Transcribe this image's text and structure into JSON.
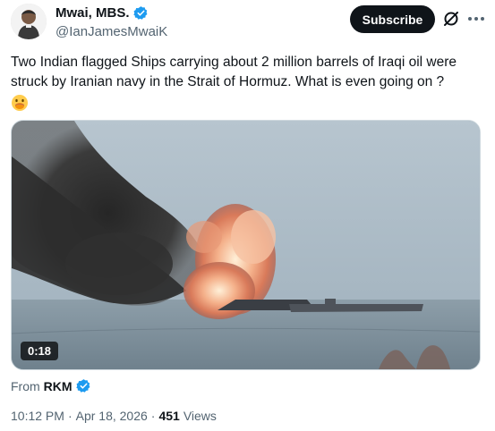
{
  "author": {
    "display_name": "Mwai, MBS.",
    "handle": "@IanJamesMwaiK",
    "verified_icon": "verified-badge-icon"
  },
  "actions": {
    "subscribe_label": "Subscribe",
    "grok_icon": "grok-icon",
    "more_icon": "more-options-icon"
  },
  "tweet": {
    "text": "Two Indian flagged Ships carrying about 2 million barrels of Iraqi oil were struck by Iranian navy in the Strait of Hormuz. What is even going on ?",
    "emoji": "face-with-hand-over-mouth-emoji"
  },
  "media": {
    "type": "video",
    "duration": "0:18",
    "description_icon": "video-thumbnail"
  },
  "source": {
    "from_label": "From",
    "name": "RKM"
  },
  "meta": {
    "time": "10:12 PM",
    "separator": "·",
    "date": "Apr 18, 2026",
    "views_count": "451",
    "views_label": "Views"
  },
  "colors": {
    "text": "#0f1419",
    "secondary": "#536471",
    "verified": "#1d9bf0",
    "button_bg": "#0f1419"
  }
}
